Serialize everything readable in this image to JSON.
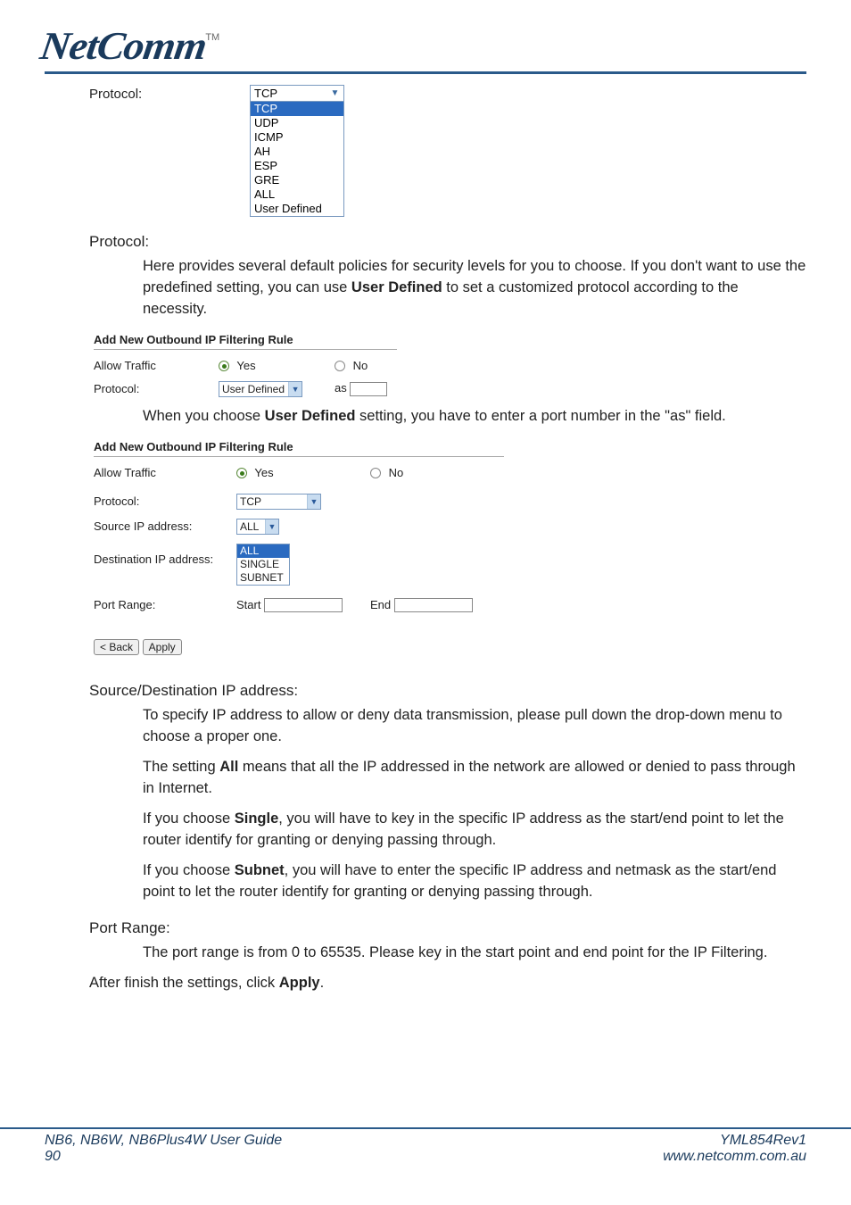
{
  "logo": {
    "text": "NetComm",
    "tm": "TM"
  },
  "protocol_top": {
    "label": "Protocol:",
    "selected": "TCP",
    "options": [
      "TCP",
      "UDP",
      "ICMP",
      "AH",
      "ESP",
      "GRE",
      "ALL",
      "User Defined"
    ],
    "highlighted": "TCP"
  },
  "section_protocol": {
    "heading": "Protocol:",
    "para_a": "Here provides several default policies for security levels for you to choose. If you don't want to use the predefined setting, you can use ",
    "para_b_bold": "User Defined",
    "para_c": " to set a customized protocol according to the necessity."
  },
  "shot1": {
    "title": "Add New Outbound IP Filtering Rule",
    "allow_label": "Allow Traffic",
    "yes": "Yes",
    "no": "No",
    "protocol_label": "Protocol:",
    "protocol_value": "User Defined",
    "as_label": "as"
  },
  "mid_para": {
    "a": "When you choose ",
    "b_bold": "User Defined",
    "c": " setting, you have to enter a port number in the \"as\" field."
  },
  "shot2": {
    "title": "Add New Outbound IP Filtering Rule",
    "allow_label": "Allow Traffic",
    "yes": "Yes",
    "no": "No",
    "protocol_label": "Protocol:",
    "protocol_value": "TCP",
    "src_label": "Source IP address:",
    "src_value": "ALL",
    "dst_label": "Destination IP address:",
    "ip_options": [
      "ALL",
      "SINGLE",
      "SUBNET"
    ],
    "ip_highlight": "ALL",
    "port_label": "Port Range:",
    "start_label": "Start",
    "end_label": "End",
    "back_btn": "< Back",
    "apply_btn": "Apply"
  },
  "section_ip": {
    "heading": "Source/Destination IP address:",
    "p1": "To specify IP address to allow or deny data transmission, please pull down the drop-down menu to choose a proper one.",
    "p2a": "The setting ",
    "p2b_bold": "All",
    "p2c": " means that all the IP addressed in the network are allowed or denied to pass through in Internet.",
    "p3a": "If you choose ",
    "p3b_bold": "Single",
    "p3c": ", you will have to key in the specific IP address as the start/end point to let the router identify for granting or denying passing through.",
    "p4a": "If you choose ",
    "p4b_bold": "Subnet",
    "p4c": ", you will have to enter the specific IP address and netmask as the start/end point to let the router identify for granting or denying passing through."
  },
  "section_port": {
    "heading": "Port Range:",
    "p1": "The port range is from 0 to 65535. Please key in the start point and end point for the IP Filtering."
  },
  "closing": {
    "a": "After finish the settings, click ",
    "b_bold": "Apply",
    "c": "."
  },
  "footer": {
    "guide": "NB6, NB6W, NB6Plus4W User Guide",
    "page": "90",
    "rev": "YML854Rev1",
    "url": "www.netcomm.com.au"
  }
}
